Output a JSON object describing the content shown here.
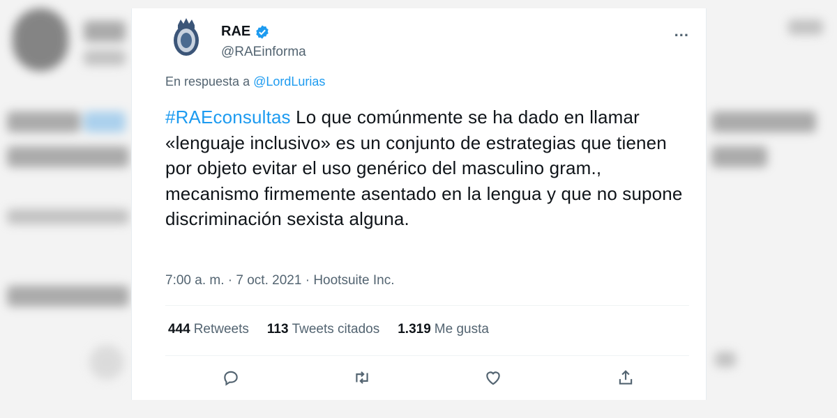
{
  "tweet": {
    "author_name": "RAE",
    "author_handle": "@RAEinforma",
    "more_icon": "...",
    "reply_prefix": "En respuesta a",
    "reply_handle": "@LordLurias",
    "hashtag": "#RAEconsultas",
    "body": "Lo que comúnmente se ha dado en llamar «lenguaje inclusivo» es un conjunto de estrategias que tienen por objeto evitar el uso genérico del masculino gram., mecanismo firmemente asentado en la lengua y que no supone discriminación sexista alguna.",
    "time": "7:00 a. m.",
    "date": "7 oct. 2021",
    "source": "Hootsuite Inc.",
    "separator": "·"
  },
  "stats": {
    "retweets_count": "444",
    "retweets_label": "Retweets",
    "quotes_count": "113",
    "quotes_label": "Tweets citados",
    "likes_count": "1.319",
    "likes_label": "Me gusta"
  },
  "colors": {
    "accent": "#1d9bf0",
    "secondary_text": "#536471",
    "primary_text": "#0f1419"
  },
  "icons": [
    "rae-emblem-icon",
    "verified-icon",
    "more-icon",
    "reply-icon",
    "retweet-icon",
    "like-icon",
    "share-icon"
  ]
}
